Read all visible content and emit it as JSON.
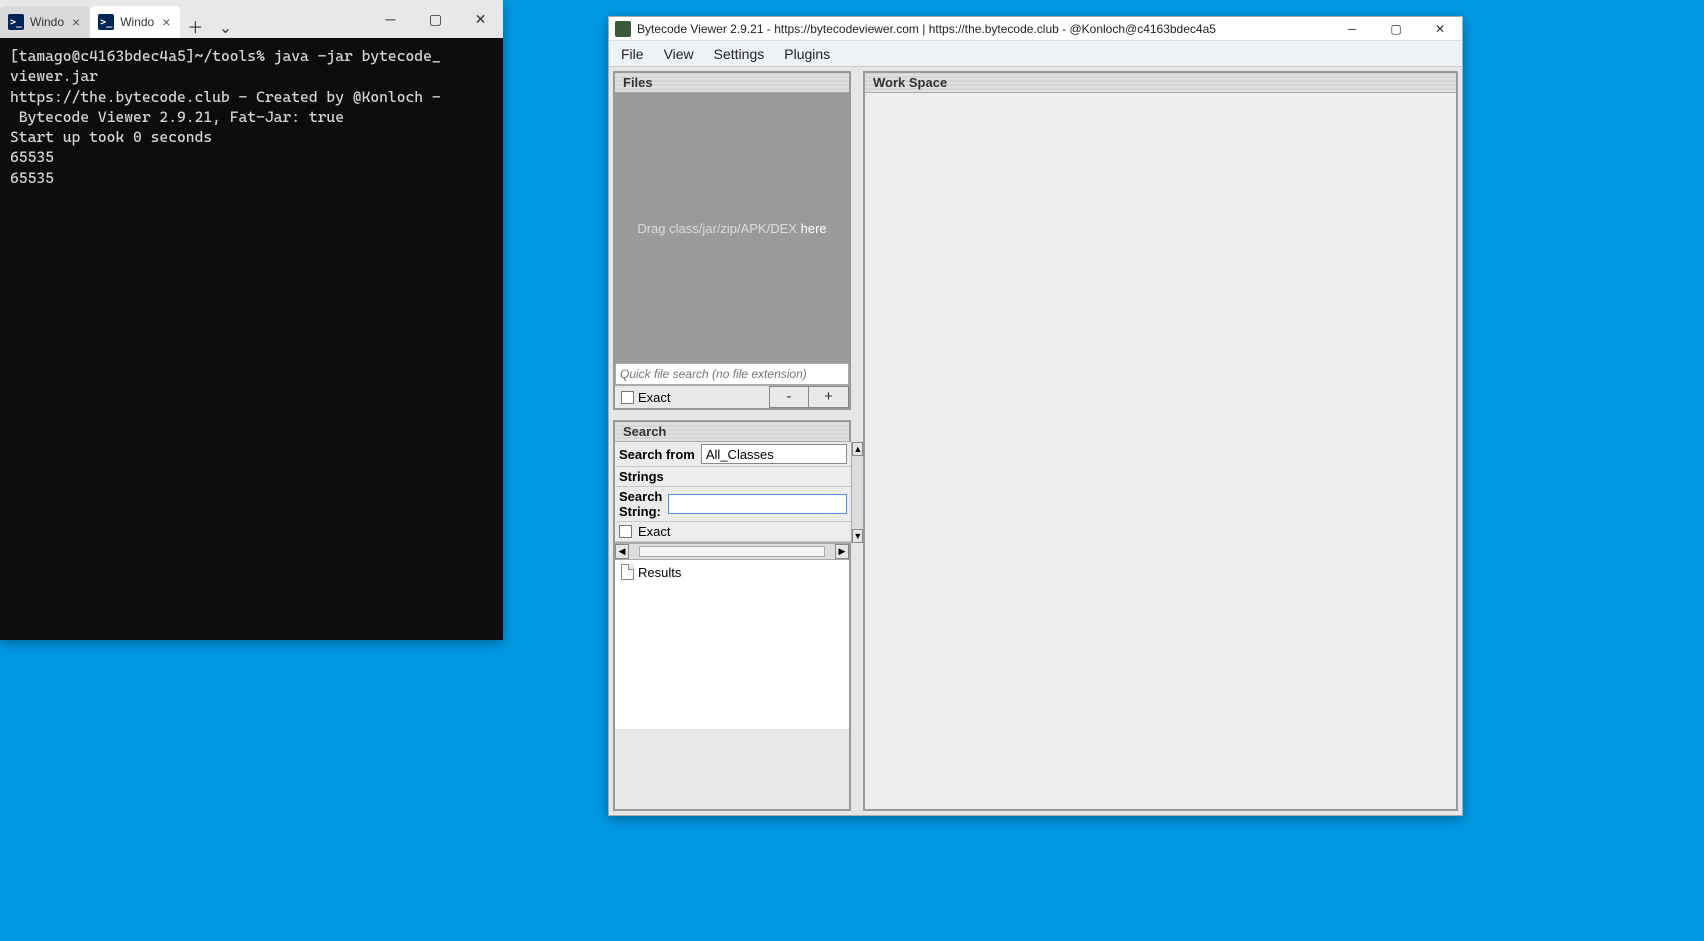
{
  "terminal": {
    "tabs": [
      {
        "label": "Windo"
      },
      {
        "label": "Windo"
      }
    ],
    "active_tab": 1,
    "body": "[tamago@c4163bdec4a5]~/tools% java -jar bytecode_\nviewer.jar\nhttps://the.bytecode.club - Created by @Konloch -\n Bytecode Viewer 2.9.21, Fat-Jar: true\nStart up took 0 seconds\n65535\n65535"
  },
  "bv": {
    "title": "Bytecode Viewer 2.9.21 - https://bytecodeviewer.com | https://the.bytecode.club - @Konloch@c4163bdec4a5",
    "menus": {
      "file": "File",
      "view": "View",
      "settings": "Settings",
      "plugins": "Plugins"
    },
    "files_panel": {
      "title": "Files",
      "drop_prefix": "Drag class/jar/zip/APK/DEX ",
      "drop_suffix": "here",
      "search_placeholder": "Quick file search (no file extension)",
      "exact_label": "Exact",
      "minus": "-",
      "plus": "+"
    },
    "search_panel": {
      "title": "Search",
      "search_from_label": "Search from",
      "search_from_value": "All_Classes",
      "strings_label": "Strings",
      "search_string_label": "Search String:",
      "search_string_value": "",
      "exact_label": "Exact",
      "results_label": "Results"
    },
    "workspace_panel": {
      "title": "Work Space"
    }
  }
}
